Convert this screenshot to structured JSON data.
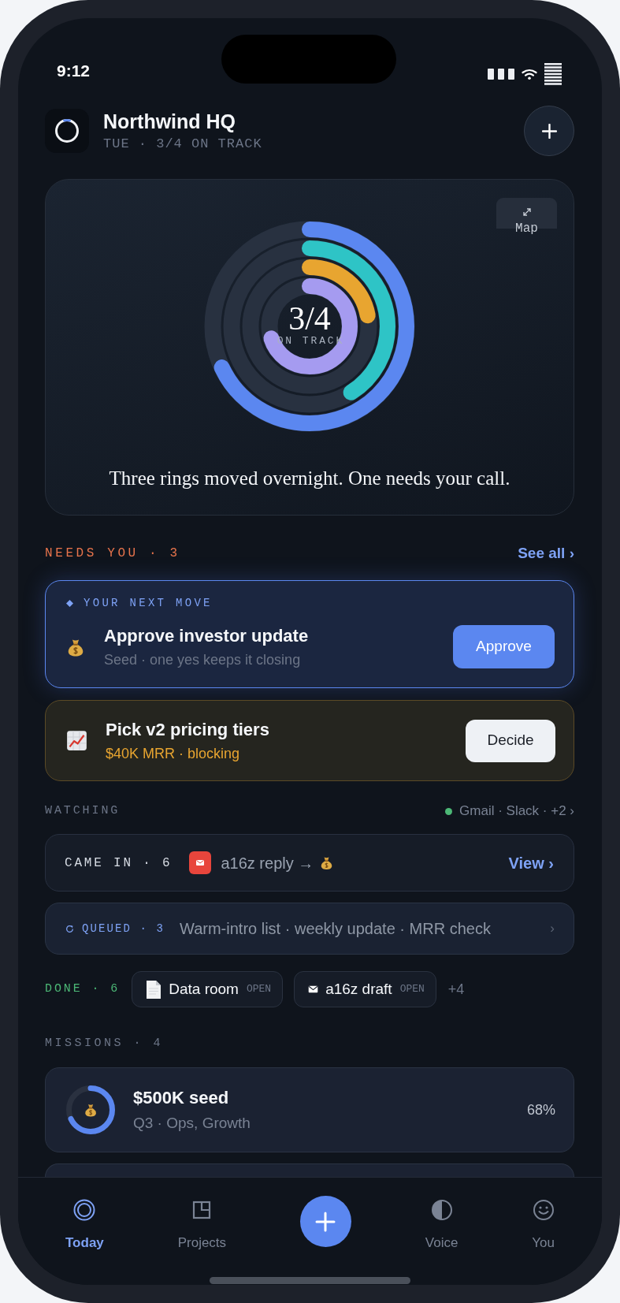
{
  "status_bar": {
    "time": "9:12"
  },
  "header": {
    "title": "Northwind HQ",
    "subtitle": "TUE · 3/4 ON TRACK"
  },
  "summary": {
    "map_label": "Map",
    "rings": [
      {
        "level": 0.68
      },
      {
        "level": 0.41
      },
      {
        "level": 0.22
      },
      {
        "level": 0.7
      }
    ],
    "value": "3/4",
    "value_label": "ON TRACK",
    "caption": "Three rings moved overnight. One needs your call."
  },
  "needs_you": {
    "heading": "NEEDS YOU · 3",
    "see_all": "See all ›",
    "items": [
      {
        "kind": "next_move",
        "eyebrow": "YOUR NEXT MOVE",
        "title": "Approve investor update",
        "subtitle": "Seed · one yes keeps it closing",
        "action": "Approve"
      },
      {
        "kind": "decision",
        "title": "Pick v2 pricing tiers",
        "subtitle": "$40K MRR · blocking",
        "action": "Decide"
      }
    ]
  },
  "watching": {
    "heading": "WATCHING",
    "live": true,
    "sources": "Gmail · Slack · +2 ›",
    "came_in": {
      "label": "CAME IN · 6",
      "text": "a16z reply →",
      "action": "View ›"
    },
    "queued": {
      "label": "QUEUED · 3",
      "text": "Warm-intro list · weekly update · MRR check",
      "chevron": "›"
    }
  },
  "done": {
    "label": "DONE · 6",
    "chips": [
      {
        "kind": "file",
        "title": "Data room",
        "badge": "OPEN"
      },
      {
        "kind": "mail",
        "title": "a16z draft",
        "badge": "OPEN"
      }
    ],
    "more": "+4"
  },
  "missions": {
    "heading": "MISSIONS · 4",
    "items": [
      {
        "title": "$500K seed",
        "subtitle": "Q3 · Ops, Growth",
        "percent": "68%",
        "level": 0.68
      }
    ]
  },
  "tab_bar": {
    "tabs": [
      {
        "label": "Today",
        "selected": true
      },
      {
        "label": "Projects",
        "selected": false
      },
      {
        "label": "Voice",
        "selected": false
      },
      {
        "label": "You",
        "selected": false
      }
    ]
  }
}
